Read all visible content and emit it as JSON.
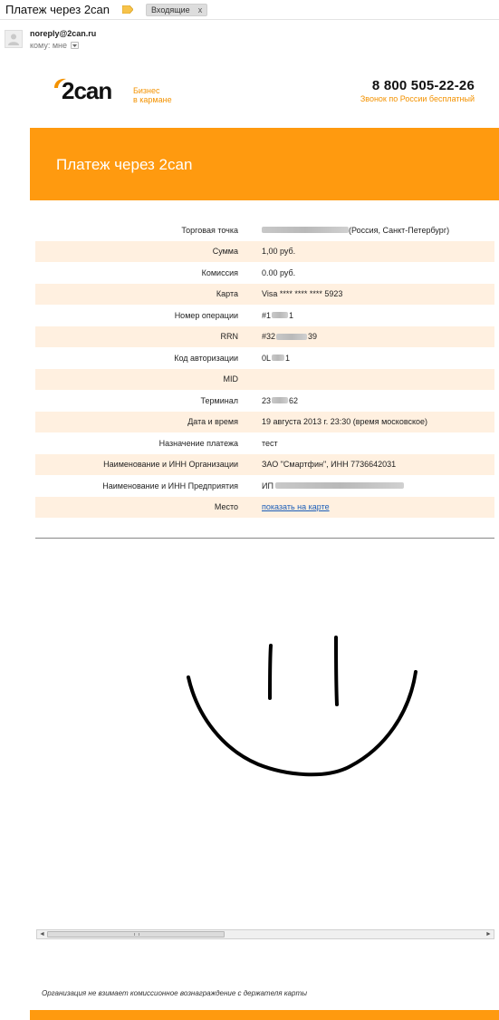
{
  "email": {
    "subject": "Платеж через 2can",
    "folder_label": "Входящие",
    "folder_label_remove": "x",
    "sender": "noreply@2can.ru",
    "recipient_line": "кому: мне"
  },
  "header": {
    "logo_text": "2can",
    "tagline_line1": "Бизнес",
    "tagline_line2": "в кармане",
    "phone": "8 800 505-22-26",
    "phone_note": "Звонок по России бесплатный",
    "brand_color": "#f39200"
  },
  "banner": {
    "title": "Платеж через 2can",
    "color": "#ff9a0f"
  },
  "details": [
    {
      "label": "Торговая точка",
      "value": "(Россия, Санкт-Петербург)"
    },
    {
      "label": "Сумма",
      "value": "1,00 руб."
    },
    {
      "label": "Комиссия",
      "value": "0.00 руб."
    },
    {
      "label": "Карта",
      "value": "Visa **** **** **** 5923"
    },
    {
      "label": "Номер операции",
      "value": "#1"
    },
    {
      "label": "RRN",
      "value": "#32"
    },
    {
      "label": "Код авторизации",
      "value": "0L"
    },
    {
      "label": "MID",
      "value": ""
    },
    {
      "label": "Терминал",
      "value": "23"
    },
    {
      "label": "Дата и время",
      "value": "19 августа 2013 г. 23:30 (время московское)"
    },
    {
      "label": "Назначение платежа",
      "value": "тест"
    },
    {
      "label": "Наименование и ИНН Организации",
      "value": "ЗАО \"Смартфин\", ИНН 7736642031"
    },
    {
      "label": "Наименование и ИНН Предприятия",
      "value": "ИП"
    },
    {
      "label": "Место",
      "value": "показать на карте"
    }
  ],
  "details_extra": {
    "operation_suffix": "1",
    "rrn_suffix": "39",
    "auth_suffix": "1",
    "terminal_suffix": "62"
  },
  "footnote": "Организация не взимает комиссионное вознаграждение с держателя карты"
}
